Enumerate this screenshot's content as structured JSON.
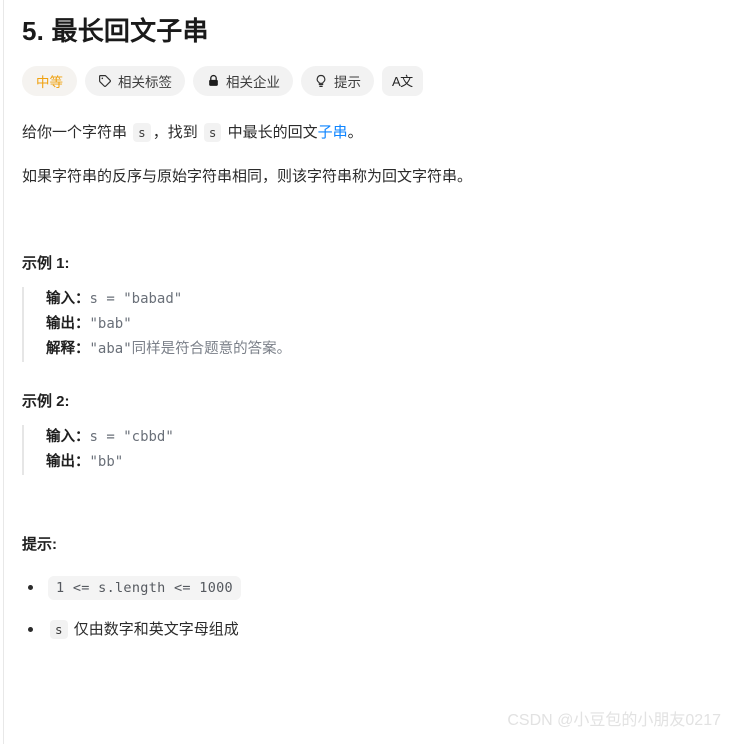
{
  "problem": {
    "title": "5. 最长回文子串",
    "difficulty": "中等",
    "tags": [
      {
        "icon": "tag-icon",
        "label": "相关标签"
      },
      {
        "icon": "lock-icon",
        "label": "相关企业"
      },
      {
        "icon": "lightbulb-icon",
        "label": "提示"
      }
    ],
    "translate_button": "A文",
    "description": {
      "p1_before_code1": "给你一个字符串 ",
      "p1_code1": "s",
      "p1_between": "，找到 ",
      "p1_code2": "s",
      "p1_after_code2": " 中最长的回文",
      "p1_link": "子串",
      "p1_end": "。",
      "p2": "如果字符串的反序与原始字符串相同，则该字符串称为回文字符串。"
    },
    "examples": [
      {
        "heading": "示例 1:",
        "input_label": "输入：",
        "input_value": "s = \"babad\"",
        "output_label": "输出：",
        "output_value": "\"bab\"",
        "explain_label": "解释：",
        "explain_code": "\"aba\"",
        "explain_text": "同样是符合题意的答案。"
      },
      {
        "heading": "示例 2:",
        "input_label": "输入：",
        "input_value": "s = \"cbbd\"",
        "output_label": "输出：",
        "output_value": "\"bb\""
      }
    ],
    "hints": {
      "heading": "提示:",
      "items": [
        {
          "code": "1 <= s.length <= 1000",
          "text": ""
        },
        {
          "code": "s",
          "text": "仅由数字和英文字母组成"
        }
      ]
    }
  },
  "watermark": "CSDN @小豆包的小朋友0217",
  "colors": {
    "difficulty": "#f0a10e",
    "link": "#0f85ff",
    "code_text": "#6a7079",
    "background": "#ffffff"
  }
}
